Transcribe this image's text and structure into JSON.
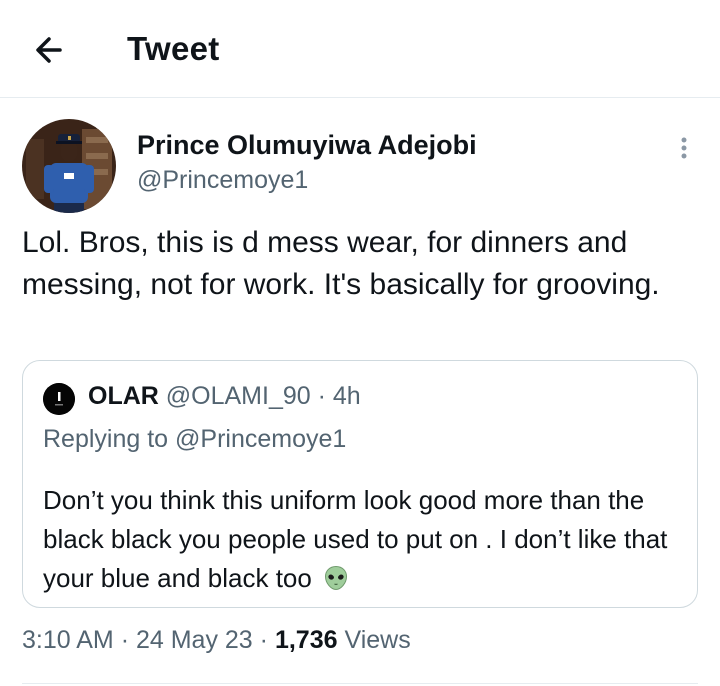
{
  "header": {
    "title": "Tweet",
    "back_icon": "arrow-left-icon"
  },
  "tweet": {
    "author_name": "Prince Olumuyiwa Adejobi",
    "author_handle": "@Princemoye1",
    "more_icon": "more-vertical-icon",
    "text": "Lol. Bros, this is d mess wear, for dinners and messing, not for work. It's basically for grooving.",
    "time": "3:10 AM",
    "date": "24 May 23",
    "views_count": "1,736",
    "views_label": "Views"
  },
  "quote": {
    "name": "OLAR",
    "handle": "@OLAMI_90",
    "age": "4h",
    "replying_to": "Replying to @Princemoye1",
    "text": "Don’t you think this uniform look good more than the black black you people used to put on . I don’t like that your blue and black too",
    "emoji_icon": "alien-emoji-icon"
  },
  "colors": {
    "text_primary": "#0f1419",
    "text_secondary": "#536471",
    "border": "#cfd9de",
    "divider": "#e6ecf0",
    "uniform_blue": "#2f5fae"
  }
}
